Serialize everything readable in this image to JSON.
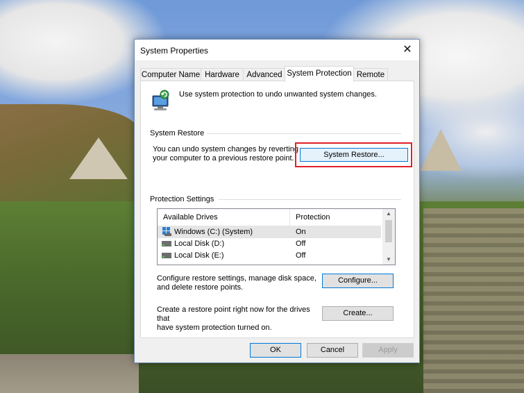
{
  "window": {
    "title": "System Properties",
    "close_symbol": "✕"
  },
  "tabs": [
    {
      "label": "Computer Name",
      "active": false
    },
    {
      "label": "Hardware",
      "active": false
    },
    {
      "label": "Advanced",
      "active": false
    },
    {
      "label": "System Protection",
      "active": true
    },
    {
      "label": "Remote",
      "active": false
    }
  ],
  "intro": {
    "text": "Use system protection to undo unwanted system changes.",
    "icon": "system-protection-icon"
  },
  "system_restore": {
    "group_label": "System Restore",
    "description_line1": "You can undo system changes by reverting",
    "description_line2": "your computer to a previous restore point.",
    "button_label": "System Restore...",
    "highlight_color": "#e0202a"
  },
  "protection_settings": {
    "group_label": "Protection Settings",
    "columns": [
      "Available Drives",
      "Protection"
    ],
    "drives": [
      {
        "name": "Windows (C:) (System)",
        "protection": "On",
        "icon": "system-drive-icon",
        "selected": true
      },
      {
        "name": "Local Disk (D:)",
        "protection": "Off",
        "icon": "disk-drive-icon",
        "selected": false
      },
      {
        "name": "Local Disk (E:)",
        "protection": "Off",
        "icon": "disk-drive-icon",
        "selected": false
      }
    ],
    "configure": {
      "text_line1": "Configure restore settings, manage disk space,",
      "text_line2": "and delete restore points.",
      "button_label": "Configure..."
    },
    "create": {
      "text_line1": "Create a restore point right now for the drives that",
      "text_line2": "have system protection turned on.",
      "button_label": "Create..."
    }
  },
  "footer": {
    "ok_label": "OK",
    "cancel_label": "Cancel",
    "apply_label": "Apply"
  },
  "colors": {
    "accent": "#0078d7",
    "dialog_bg": "#f0f0f0"
  }
}
